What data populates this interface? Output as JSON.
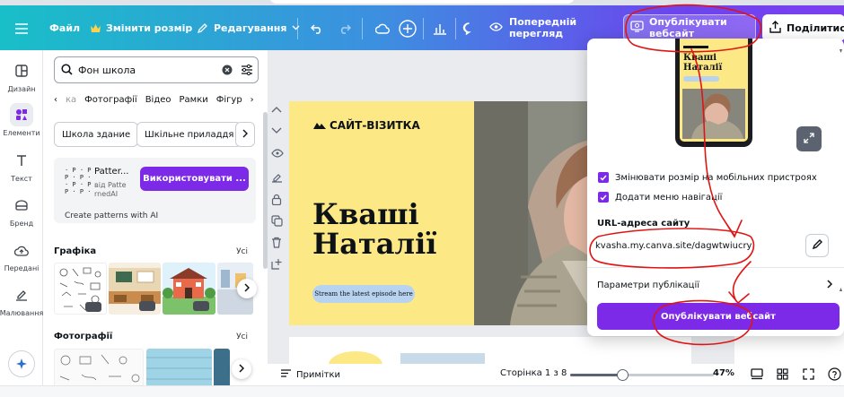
{
  "topbar": {
    "menu_icon": "hamburger-icon",
    "file": "Файл",
    "resize": "Змінити розмір",
    "edit": "Редагування",
    "preview": "Попередній перегляд",
    "publish": "Опублікувати вебсайт",
    "share": "Поділитися"
  },
  "rail": {
    "items": [
      {
        "label": "Дизайн",
        "icon": "design-icon"
      },
      {
        "label": "Елементи",
        "icon": "elements-icon"
      },
      {
        "label": "Текст",
        "icon": "text-icon"
      },
      {
        "label": "Бренд",
        "icon": "brand-icon"
      },
      {
        "label": "Передані",
        "icon": "uploads-icon"
      },
      {
        "label": "Малювання",
        "icon": "draw-icon"
      }
    ]
  },
  "panel": {
    "search_value": "Фон школа",
    "tabs": [
      "‹",
      "ка",
      "Фотографії",
      "Відео",
      "Рамки",
      "Фігур",
      "›"
    ],
    "chips": [
      "Школа здание",
      "Шкільне приладдя"
    ],
    "patterns": {
      "title": "Patter...",
      "sub1": "від Patte",
      "sub2": "rnedAI",
      "button": "Використовувати ...",
      "footer": "Create patterns with AI"
    },
    "graphics_title": "Графіка",
    "graphics_all": "Усі",
    "photos_title": "Фотографії",
    "photos_all": "Усі"
  },
  "page": {
    "logo": "САЙТ-ВІЗИТКА",
    "title_line1": "Кваші",
    "title_line2": "Наталії",
    "pill": "Stream the latest episode here"
  },
  "footer": {
    "notes": "Примітки",
    "page": "Сторінка 1 з 8",
    "zoom": "47%",
    "zoom_fraction": 0.36
  },
  "publish_panel": {
    "phone_title1": "Кваші",
    "phone_title2": "Наталії",
    "checkbox_resize": "Змінювати розмір на мобільних пристроях",
    "checkbox_nav": "Додати меню навігації",
    "url_label": "URL-адреса сайту",
    "url": "kvasha.my.canva.site/dagwtwiucry",
    "params": "Параметри публікації",
    "publish_button": "Опублікувати вебсайт"
  },
  "colors": {
    "accent": "#7d2ae8",
    "page_yellow": "#fde886",
    "annotation": "#e11414"
  }
}
